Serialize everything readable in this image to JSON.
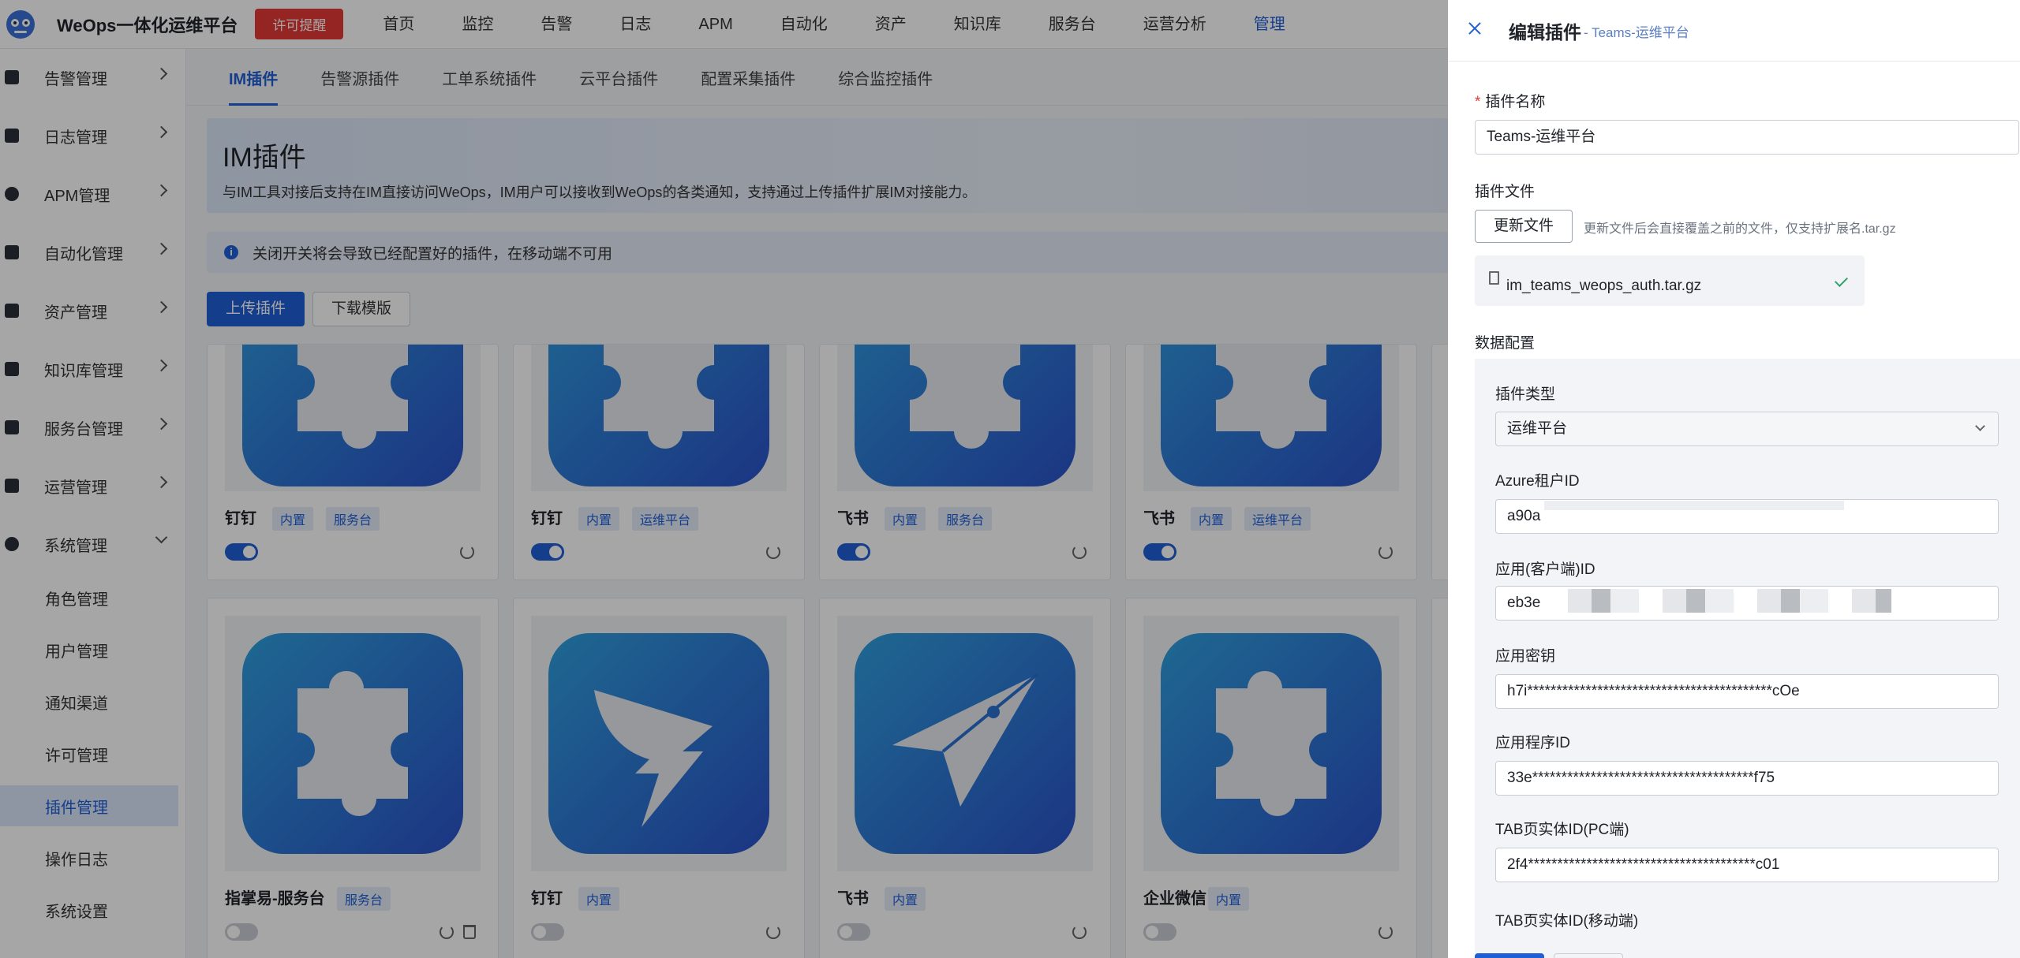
{
  "header": {
    "app_title": "WeOps一体化运维平台",
    "license_badge": "许可提醒",
    "nav": [
      {
        "label": "首页"
      },
      {
        "label": "监控"
      },
      {
        "label": "告警"
      },
      {
        "label": "日志"
      },
      {
        "label": "APM"
      },
      {
        "label": "自动化"
      },
      {
        "label": "资产"
      },
      {
        "label": "知识库"
      },
      {
        "label": "服务台"
      },
      {
        "label": "运营分析"
      },
      {
        "label": "管理"
      }
    ],
    "active_nav": "管理",
    "accent_color": "#1f5fd6",
    "badge_color": "#e53935"
  },
  "sidebar": {
    "items": [
      {
        "label": "告警管理"
      },
      {
        "label": "日志管理"
      },
      {
        "label": "APM管理"
      },
      {
        "label": "自动化管理"
      },
      {
        "label": "资产管理"
      },
      {
        "label": "知识库管理"
      },
      {
        "label": "服务台管理"
      },
      {
        "label": "运营管理"
      },
      {
        "label": "系统管理"
      }
    ],
    "sub_items": [
      {
        "label": "角色管理"
      },
      {
        "label": "用户管理"
      },
      {
        "label": "通知渠道"
      },
      {
        "label": "许可管理"
      },
      {
        "label": "插件管理"
      },
      {
        "label": "操作日志"
      },
      {
        "label": "系统设置"
      }
    ],
    "active_sub": "插件管理"
  },
  "main": {
    "tabs": [
      {
        "label": "IM插件"
      },
      {
        "label": "告警源插件"
      },
      {
        "label": "工单系统插件"
      },
      {
        "label": "云平台插件"
      },
      {
        "label": "配置采集插件"
      },
      {
        "label": "综合监控插件"
      }
    ],
    "banner_title": "IM插件",
    "banner_desc": "与IM工具对接后支持在IM直接访问WeOps，IM用户可以接收到WeOps的各类通知，支持通过上传插件扩展IM对接能力。",
    "info_text": "关闭开关将会导致已经配置好的插件，在移动端不可用",
    "upload_btn": "上传插件",
    "download_btn": "下载模版",
    "cards_row1": [
      {
        "name": "钉钉",
        "tag1": "内置",
        "tag2": "服务台",
        "enabled": true
      },
      {
        "name": "钉钉",
        "tag1": "内置",
        "tag2": "运维平台",
        "enabled": true
      },
      {
        "name": "飞书",
        "tag1": "内置",
        "tag2": "服务台",
        "enabled": true
      },
      {
        "name": "飞书",
        "tag1": "内置",
        "tag2": "运维平台",
        "enabled": true
      }
    ],
    "cards_row2": [
      {
        "name": "指掌易-服务台",
        "tag1": "服务台",
        "enabled": false
      },
      {
        "name": "钉钉",
        "tag1": "内置",
        "enabled": false
      },
      {
        "name": "飞书",
        "tag1": "内置",
        "enabled": false
      },
      {
        "name": "企业微信",
        "tag1": "内置",
        "enabled": false
      }
    ]
  },
  "drawer": {
    "title": "编辑插件",
    "subtitle": "- Teams-运维平台",
    "name_label": "插件名称",
    "name_value": "Teams-运维平台",
    "file_label": "插件文件",
    "update_btn": "更新文件",
    "update_hint": "更新文件后会直接覆盖之前的文件，仅支持扩展名.tar.gz",
    "file_name": "im_teams_weops_auth.tar.gz",
    "data_config_title": "数据配置",
    "fields": {
      "plugin_type_label": "插件类型",
      "plugin_type_value": "运维平台",
      "azure_tenant_label": "Azure租户ID",
      "azure_tenant_value": "a90a",
      "client_id_label": "应用(客户端)ID",
      "client_id_value": "eb3e",
      "secret_label": "应用密钥",
      "secret_value": "h7i******************************************cOe",
      "app_id_label": "应用程序ID",
      "app_id_value": "33e**************************************f75",
      "tab_pc_label": "TAB页实体ID(PC端)",
      "tab_pc_value": "2f4***************************************c01",
      "tab_mobile_label": "TAB页实体ID(移动端)"
    }
  }
}
